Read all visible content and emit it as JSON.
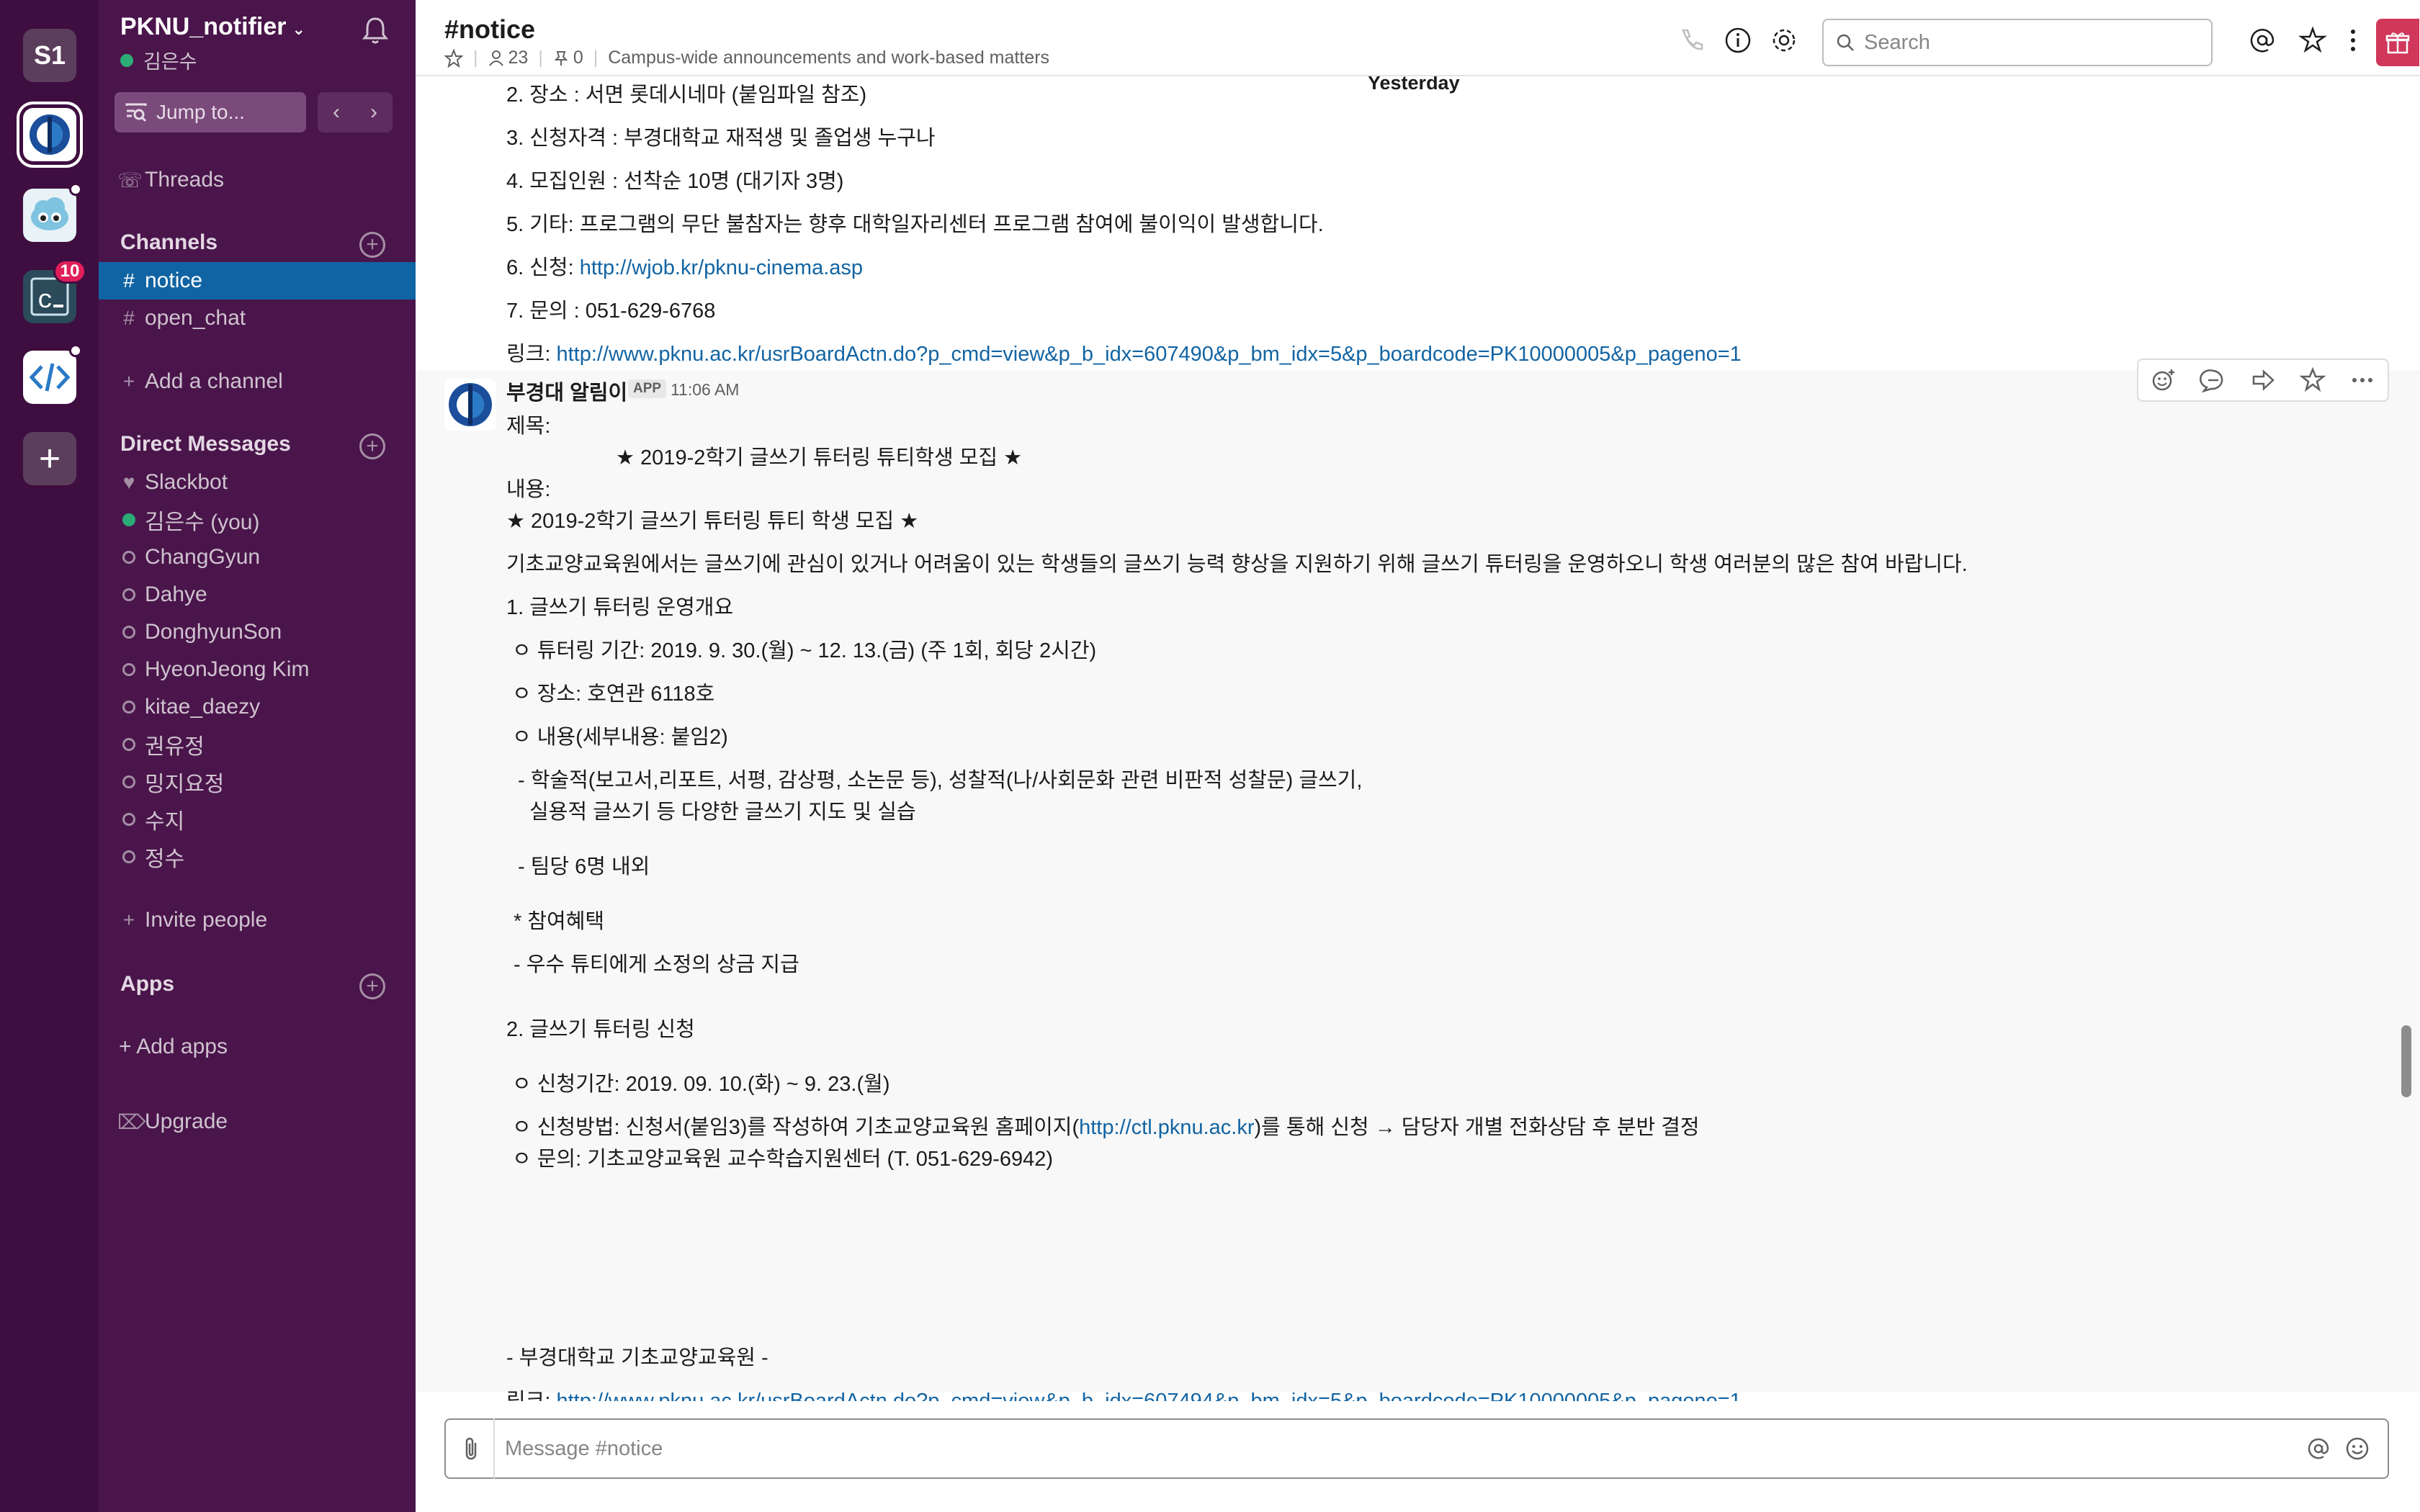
{
  "rail": {
    "workspaces": [
      {
        "label": "S1",
        "name": "workspace-s1"
      },
      {
        "label": "PKNU",
        "name": "workspace-pknu"
      },
      {
        "label": "cloud",
        "name": "workspace-cloud"
      },
      {
        "label": "C",
        "name": "workspace-c"
      },
      {
        "label": "code",
        "name": "workspace-code"
      }
    ],
    "c_badge": "10",
    "add_label": "+"
  },
  "sidebar": {
    "team_name": "PKNU_notifier",
    "user_name": "김은수",
    "jump_to": "Jump to...",
    "threads": "Threads",
    "channels_header": "Channels",
    "channels": [
      {
        "name": "notice",
        "active": true
      },
      {
        "name": "open_chat",
        "active": false
      }
    ],
    "add_channel": "Add a channel",
    "dm_header": "Direct Messages",
    "dms": [
      {
        "name": "Slackbot",
        "status": "heart"
      },
      {
        "name": "김은수  (you)",
        "status": "online"
      },
      {
        "name": "ChangGyun",
        "status": "away"
      },
      {
        "name": "Dahye",
        "status": "away"
      },
      {
        "name": "DonghyunSon",
        "status": "away"
      },
      {
        "name": "HyeonJeong Kim",
        "status": "away"
      },
      {
        "name": "kitae_daezy",
        "status": "away"
      },
      {
        "name": "권유정",
        "status": "away"
      },
      {
        "name": "밍지요정",
        "status": "away"
      },
      {
        "name": "수지",
        "status": "away"
      },
      {
        "name": "정수",
        "status": "away"
      }
    ],
    "invite": "Invite people",
    "apps_header": "Apps",
    "add_apps": "+ Add apps",
    "upgrade": "Upgrade"
  },
  "header": {
    "channel_title": "#notice",
    "members": "23",
    "pins": "0",
    "topic": "Campus-wide announcements and work-based matters",
    "search_placeholder": "Search"
  },
  "messages": {
    "day_divider": "Yesterday",
    "prev_lines": [
      {
        "text": "2. 장소 : 서면 롯데시네마 (붙임파일 참조)"
      },
      {
        "text": "3. 신청자격 : 부경대학교 재적생 및 졸업생 누구나"
      },
      {
        "text": "4. 모집인원 : 선착순 10명 (대기자 3명)"
      },
      {
        "text": "5. 기타: 프로그램의 무단 불참자는 향후 대학일자리센터 프로그램 참여에 불이익이 발생합니다."
      },
      {
        "prefix": "6. 신청: ",
        "link": "http://wjob.kr/pknu-cinema.asp"
      },
      {
        "text": "7. 문의 : 051-629-6768"
      },
      {
        "prefix": "링크: ",
        "link": "http://www.pknu.ac.kr/usrBoardActn.do?p_cmd=view&p_b_idx=607490&p_bm_idx=5&p_boardcode=PK10000005&p_pageno=1"
      }
    ],
    "main": {
      "sender": "부경대 알림이",
      "app_tag": "APP",
      "time": "11:06 AM",
      "lines": [
        {
          "text": "제목:"
        },
        {
          "text": "★ 2019-2학기 글쓰기 튜터링 튜티학생 모집 ★"
        },
        {
          "text": "내용:"
        },
        {
          "text": "★ 2019-2학기 글쓰기 튜터링 튜티 학생 모집 ★"
        },
        {
          "text": "기초교양교육원에서는 글쓰기에 관심이 있거나 어려움이 있는 학생들의 글쓰기 능력 향상을 지원하기 위해 글쓰기 튜터링을 운영하오니 학생 여러분의 많은 참여 바랍니다."
        },
        {
          "text": "1.  글쓰기 튜터링 운영개요"
        },
        {
          "text": "ㅇ 튜터링 기간: 2019. 9. 30.(월) ~ 12. 13.(금)  (주 1회, 회당 2시간)"
        },
        {
          "text": "ㅇ 장소: 호연관 6118호"
        },
        {
          "text": "ㅇ 내용(세부내용: 붙임2)"
        },
        {
          "text": "- 학술적(보고서,리포트, 서평, 감상평, 소논문 등), 성찰적(나/사회문화 관련 비판적 성찰문) 글쓰기,"
        },
        {
          "text": "실용적 글쓰기 등 다양한 글쓰기 지도 및 실습"
        },
        {
          "text": "- 팀당 6명 내외"
        },
        {
          "text": "* 참여혜택"
        },
        {
          "text": "- 우수 튜티에게 소정의 상금 지급"
        },
        {
          "text": "2. 글쓰기 튜터링 신청"
        },
        {
          "text": "ㅇ 신청기간: 2019. 09. 10.(화) ~ 9. 23.(월)"
        },
        {
          "prefix": "ㅇ 신청방법:  신청서(붙임3)를 작성하여 기초교양교육원 홈페이지(",
          "link": "http://ctl.pknu.ac.kr",
          "suffix": ")를 통해 신청 → 담당자 개별 전화상담 후 분반 결정"
        },
        {
          "text": "ㅇ 문의: 기초교양교육원 교수학습지원센터 (T. 051-629-6942)"
        },
        {
          "text": "- 부경대학교 기초교양교육원 -"
        },
        {
          "prefix": "링크: ",
          "link": "http://www.pknu.ac.kr/usrBoardActn.do?p_cmd=view&p_b_idx=607494&p_bm_idx=5&p_boardcode=PK10000005&p_pageno=1"
        }
      ]
    }
  },
  "composer": {
    "placeholder": "Message #notice"
  },
  "colors": {
    "rail": "#3f0e40",
    "sidebar": "#4a154b",
    "active_channel": "#1164a3",
    "link": "#1264a3",
    "badge": "#e01e5a"
  }
}
